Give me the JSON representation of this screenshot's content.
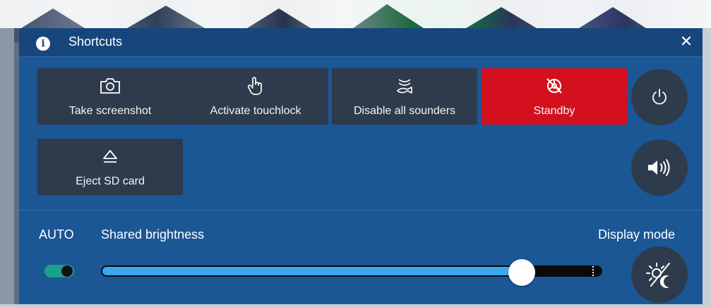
{
  "header": {
    "title": "Shortcuts"
  },
  "tiles": [
    {
      "label": "Take screenshot",
      "icon": "camera-icon"
    },
    {
      "label": "Activate touchlock",
      "icon": "touch-hand-icon"
    },
    {
      "label": "Disable all sounders",
      "icon": "sounder-off-icon"
    },
    {
      "label": "Standby",
      "icon": "standby-off-icon",
      "color": "#d5101e"
    },
    {
      "label": "Eject SD card",
      "icon": "eject-icon"
    }
  ],
  "side_buttons": [
    {
      "icon": "power-icon"
    },
    {
      "icon": "volume-icon"
    },
    {
      "icon": "day-night-icon"
    }
  ],
  "brightness": {
    "auto_label": "AUTO",
    "auto_enabled": true,
    "label": "Shared brightness",
    "level": 0.84
  },
  "display_mode": {
    "label": "Display mode"
  },
  "colors": {
    "panel": "#1b5695",
    "header": "#17467d",
    "tile": "#2e3b4c",
    "accent_red": "#d5101e",
    "slider_fill": "#3aa8f0",
    "toggle_on": "#1e9e8a"
  }
}
